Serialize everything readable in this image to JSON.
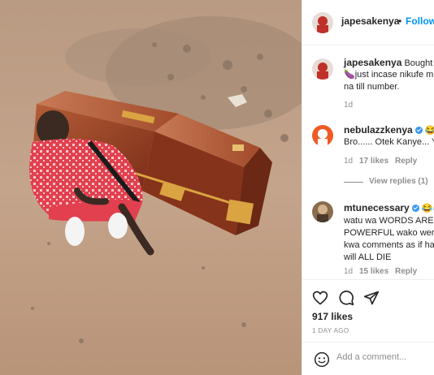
{
  "post": {
    "username": "japesakenya",
    "follow_label": "Follow",
    "dot": "•"
  },
  "caption": {
    "username": "japesakenya",
    "line1": "Bought m",
    "line2": "🍆just incase nikufe m",
    "line3": "na till number.",
    "time": "1d"
  },
  "comments": [
    {
      "username": "nebulazzkenya",
      "emoji": "😂",
      "lines": [
        "Bro...... Otek Kanye... Y"
      ],
      "time": "1d",
      "likes": "17 likes",
      "reply": "Reply",
      "view_replies": "View replies (1)"
    },
    {
      "username": "mtunecessary",
      "emoji": "😂😂",
      "lines": [
        "watu wa WORDS ARE",
        "POWERFUL wako weng",
        "kwa comments as if ha",
        "will ALL DIE"
      ],
      "time": "1d",
      "likes": "15 likes",
      "reply": "Reply"
    }
  ],
  "footer": {
    "likes": "917 likes",
    "date": "1 DAY AGO",
    "comment_placeholder": "Add a comment..."
  },
  "icons": {
    "like": "heart-icon",
    "comment": "comment-icon",
    "share": "paper-plane-icon",
    "emoji": "emoji-icon"
  },
  "colors": {
    "follow": "#0095f6",
    "text": "#262626",
    "muted": "#8e8e8e",
    "verified": "#3897f0"
  }
}
